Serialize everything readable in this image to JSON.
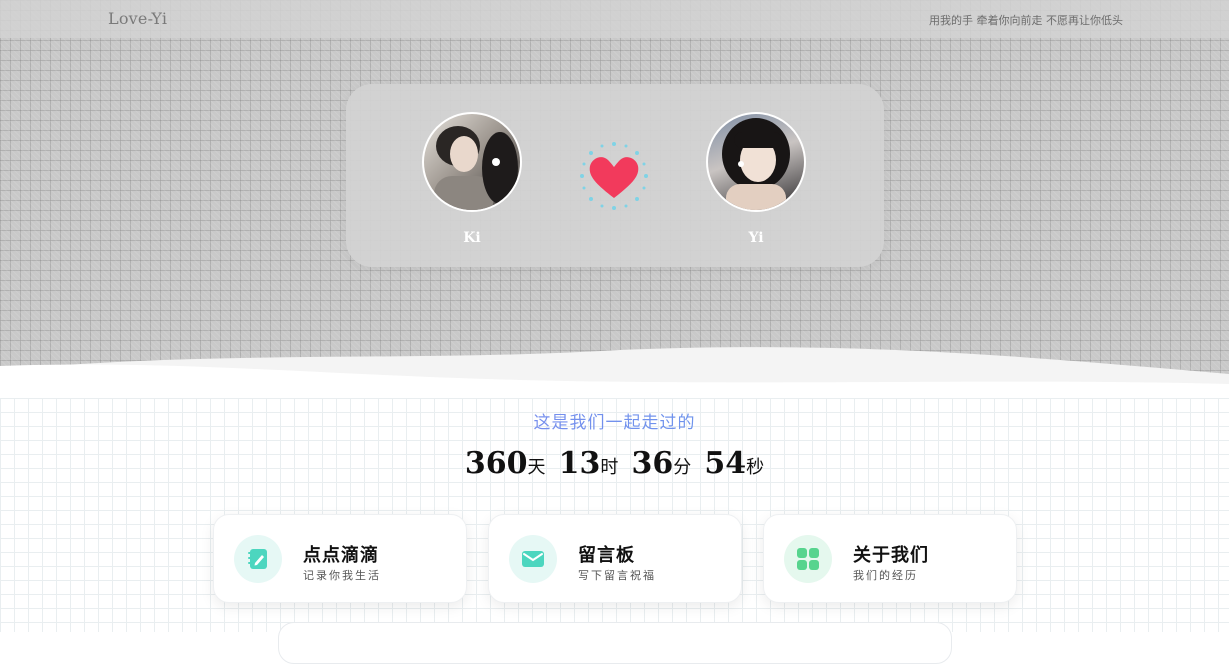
{
  "header": {
    "brand": "Love-Yi",
    "motto": "用我的手 牵着你向前走 不愿再让你低头"
  },
  "couple": {
    "left_name": "Ki",
    "right_name": "Yi",
    "heart_color": "#f23a5c",
    "sparkle_color": "#7fd3e6"
  },
  "counter": {
    "heading": "这是我们一起走过的",
    "days": "360",
    "days_unit": "天",
    "hours": "13",
    "hours_unit": "时",
    "minutes": "36",
    "minutes_unit": "分",
    "seconds": "54",
    "seconds_unit": "秒"
  },
  "nav": [
    {
      "title": "点点滴滴",
      "subtitle": "记录你我生活",
      "icon": "notebook-icon"
    },
    {
      "title": "留言板",
      "subtitle": "写下留言祝福",
      "icon": "mail-icon"
    },
    {
      "title": "关于我们",
      "subtitle": "我们的经历",
      "icon": "grid-icon"
    }
  ],
  "colors": {
    "accent": "#4cd6bf",
    "icon_bg": "#e6f8f5"
  }
}
